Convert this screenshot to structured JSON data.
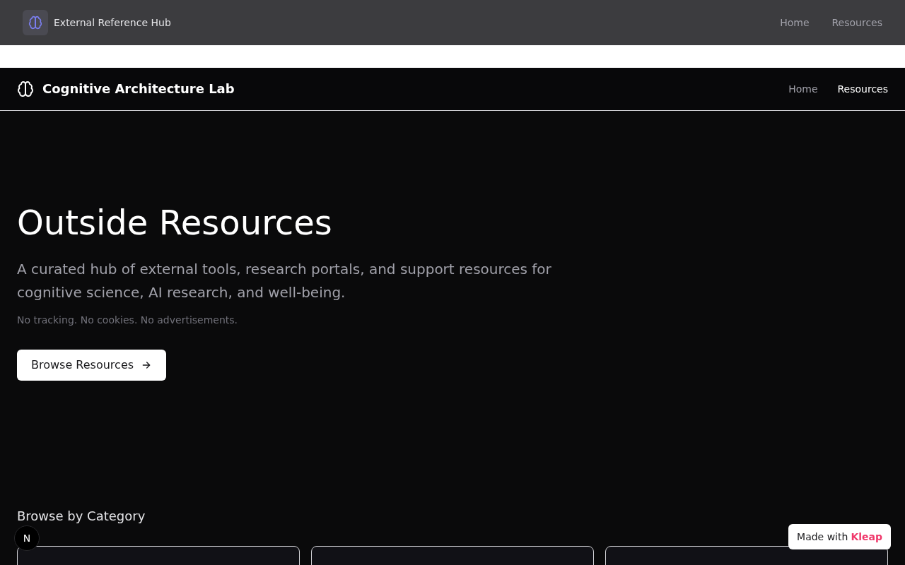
{
  "top_bar": {
    "title": "External Reference Hub",
    "links": [
      {
        "label": "Home",
        "selected": false
      },
      {
        "label": "Resources",
        "selected": false
      }
    ]
  },
  "site_nav": {
    "title": "Cognitive Architecture Lab",
    "links": [
      {
        "label": "Home",
        "selected": false
      },
      {
        "label": "Resources",
        "selected": true
      }
    ]
  },
  "hero": {
    "heading": "Outside Resources",
    "lead": "A curated hub of external tools, research portals, and support resources for cognitive science, AI research, and well-being.",
    "note": "No tracking. No cookies. No advertisements.",
    "button": "Browse Resources"
  },
  "categories": {
    "heading": "Browse by Category",
    "cards": [
      {
        "kind": "card"
      },
      {
        "kind": "card"
      },
      {
        "kind": "card"
      }
    ]
  },
  "dev_badge": {
    "letter": "N"
  },
  "made_with": {
    "text": "Made with",
    "brand": "Kleap"
  }
}
